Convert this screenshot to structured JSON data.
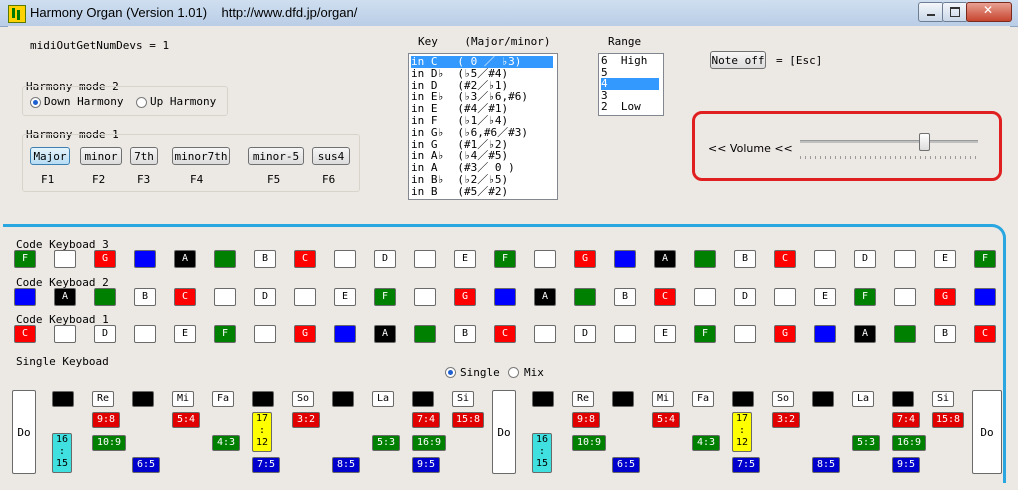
{
  "window": {
    "title": "Harmony Organ (Version 1.01)    http://www.dfd.jp/organ/"
  },
  "midi_devs": "midiOutGetNumDevs = 1",
  "mode2": {
    "label": "Harmony mode 2",
    "options": [
      {
        "label": "Down Harmony",
        "selected": true
      },
      {
        "label": "Up Harmony",
        "selected": false
      }
    ]
  },
  "mode1": {
    "label": "Harmony mode 1",
    "buttons": [
      {
        "label": "Major",
        "key": "F1",
        "selected": true
      },
      {
        "label": "minor",
        "key": "F2",
        "selected": false
      },
      {
        "label": "7th",
        "key": "F3",
        "selected": false
      },
      {
        "label": "minor7th",
        "key": "F4",
        "selected": false
      },
      {
        "label": "minor-5",
        "key": "F5",
        "selected": false
      },
      {
        "label": "sus4",
        "key": "F6",
        "selected": false
      }
    ]
  },
  "key_list": {
    "label": "Key    (Major/minor)",
    "items": [
      {
        "text": "in C   ( 0 ／ ♭3)",
        "selected": true
      },
      {
        "text": "in D♭  (♭5／#4)",
        "selected": false
      },
      {
        "text": "in D   (#2／♭1)",
        "selected": false
      },
      {
        "text": "in E♭  (♭3／♭6,#6)",
        "selected": false
      },
      {
        "text": "in E   (#4／#1)",
        "selected": false
      },
      {
        "text": "in F   (♭1／♭4)",
        "selected": false
      },
      {
        "text": "in G♭  (♭6,#6／#3)",
        "selected": false
      },
      {
        "text": "in G   (#1／♭2)",
        "selected": false
      },
      {
        "text": "in A♭  (♭4／#5)",
        "selected": false
      },
      {
        "text": "in A   (#3／ 0 )",
        "selected": false
      },
      {
        "text": "in B♭  (♭2／♭5)",
        "selected": false
      },
      {
        "text": "in B   (#5／#2)",
        "selected": false
      }
    ]
  },
  "range_list": {
    "label": "Range",
    "items": [
      {
        "text": "6  High",
        "selected": false
      },
      {
        "text": "5",
        "selected": false
      },
      {
        "text": "4",
        "selected": true
      },
      {
        "text": "3",
        "selected": false
      },
      {
        "text": "2  Low",
        "selected": false
      }
    ]
  },
  "note_off": {
    "label": "Note off",
    "hint": "= [Esc]"
  },
  "volume": {
    "label": "<< Volume <<",
    "level": 0.7
  },
  "code_keyboards": [
    {
      "label": "Code Keyboad 3",
      "keys": [
        {
          "t": "F",
          "c": "green"
        },
        {
          "t": "",
          "c": "white"
        },
        {
          "t": "G",
          "c": "red"
        },
        {
          "t": "",
          "c": "blue"
        },
        {
          "t": "A",
          "c": "black"
        },
        {
          "t": "",
          "c": "green"
        },
        {
          "t": "B",
          "c": "white"
        },
        {
          "t": "C",
          "c": "red"
        },
        {
          "t": "",
          "c": "white"
        },
        {
          "t": "D",
          "c": "white"
        },
        {
          "t": "",
          "c": "white"
        },
        {
          "t": "E",
          "c": "white"
        },
        {
          "t": "F",
          "c": "green"
        },
        {
          "t": "",
          "c": "white"
        },
        {
          "t": "G",
          "c": "red"
        },
        {
          "t": "",
          "c": "blue"
        },
        {
          "t": "A",
          "c": "black"
        },
        {
          "t": "",
          "c": "green"
        },
        {
          "t": "B",
          "c": "white"
        },
        {
          "t": "C",
          "c": "red"
        },
        {
          "t": "",
          "c": "white"
        },
        {
          "t": "D",
          "c": "white"
        },
        {
          "t": "",
          "c": "white"
        },
        {
          "t": "E",
          "c": "white"
        },
        {
          "t": "F",
          "c": "green"
        }
      ]
    },
    {
      "label": "Code Keyboad 2",
      "keys": [
        {
          "t": "",
          "c": "blue"
        },
        {
          "t": "A",
          "c": "black"
        },
        {
          "t": "",
          "c": "green"
        },
        {
          "t": "B",
          "c": "white"
        },
        {
          "t": "C",
          "c": "red"
        },
        {
          "t": "",
          "c": "white"
        },
        {
          "t": "D",
          "c": "white"
        },
        {
          "t": "",
          "c": "white"
        },
        {
          "t": "E",
          "c": "white"
        },
        {
          "t": "F",
          "c": "green"
        },
        {
          "t": "",
          "c": "white"
        },
        {
          "t": "G",
          "c": "red"
        },
        {
          "t": "",
          "c": "blue"
        },
        {
          "t": "A",
          "c": "black"
        },
        {
          "t": "",
          "c": "green"
        },
        {
          "t": "B",
          "c": "white"
        },
        {
          "t": "C",
          "c": "red"
        },
        {
          "t": "",
          "c": "white"
        },
        {
          "t": "D",
          "c": "white"
        },
        {
          "t": "",
          "c": "white"
        },
        {
          "t": "E",
          "c": "white"
        },
        {
          "t": "F",
          "c": "green"
        },
        {
          "t": "",
          "c": "white"
        },
        {
          "t": "G",
          "c": "red"
        },
        {
          "t": "",
          "c": "blue"
        }
      ]
    },
    {
      "label": "Code Keyboad 1",
      "keys": [
        {
          "t": "C",
          "c": "red"
        },
        {
          "t": "",
          "c": "white"
        },
        {
          "t": "D",
          "c": "white"
        },
        {
          "t": "",
          "c": "white"
        },
        {
          "t": "E",
          "c": "white"
        },
        {
          "t": "F",
          "c": "green"
        },
        {
          "t": "",
          "c": "white"
        },
        {
          "t": "G",
          "c": "red"
        },
        {
          "t": "",
          "c": "blue"
        },
        {
          "t": "A",
          "c": "black"
        },
        {
          "t": "",
          "c": "green"
        },
        {
          "t": "B",
          "c": "white"
        },
        {
          "t": "C",
          "c": "red"
        },
        {
          "t": "",
          "c": "white"
        },
        {
          "t": "D",
          "c": "white"
        },
        {
          "t": "",
          "c": "white"
        },
        {
          "t": "E",
          "c": "white"
        },
        {
          "t": "F",
          "c": "green"
        },
        {
          "t": "",
          "c": "white"
        },
        {
          "t": "G",
          "c": "red"
        },
        {
          "t": "",
          "c": "blue"
        },
        {
          "t": "A",
          "c": "black"
        },
        {
          "t": "",
          "c": "green"
        },
        {
          "t": "B",
          "c": "white"
        },
        {
          "t": "C",
          "c": "red"
        }
      ]
    }
  ],
  "single": {
    "label": "Single Keyboad",
    "modes": [
      {
        "label": "Single",
        "selected": true
      },
      {
        "label": "Mix",
        "selected": false
      }
    ],
    "do_label": "Do",
    "octave_notes": [
      "Re",
      "Mi",
      "Fa",
      "So",
      "La",
      "Si"
    ],
    "ratios": {
      "r98": "9:8",
      "r54": "5:4",
      "r32": "3:2",
      "r74": "7:4",
      "r158": "15:8",
      "r109": "10:9",
      "r43": "4:3",
      "r53": "5:3",
      "r169": "16:9",
      "r65": "6:5",
      "r75": "7:5",
      "r85": "8:5",
      "r95": "9:5",
      "r1615": "16\n:\n15",
      "r1712": "17\n:\n12"
    }
  }
}
